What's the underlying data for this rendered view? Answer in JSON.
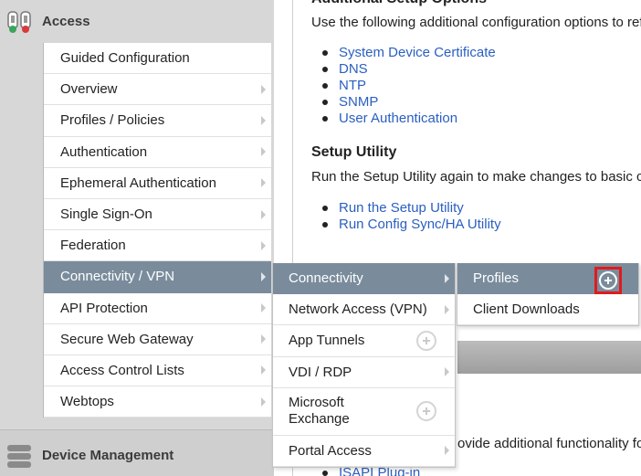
{
  "rail": {
    "header_title": "Access",
    "footer_title": "Device Management"
  },
  "menu": {
    "items": [
      {
        "label": "Guided Configuration"
      },
      {
        "label": "Overview"
      },
      {
        "label": "Profiles / Policies"
      },
      {
        "label": "Authentication"
      },
      {
        "label": "Ephemeral Authentication"
      },
      {
        "label": "Single Sign-On"
      },
      {
        "label": "Federation"
      },
      {
        "label": "Connectivity / VPN"
      },
      {
        "label": "API Protection"
      },
      {
        "label": "Secure Web Gateway"
      },
      {
        "label": "Access Control Lists"
      },
      {
        "label": "Webtops"
      }
    ]
  },
  "submenu": {
    "items": [
      {
        "label": "Connectivity"
      },
      {
        "label": "Network Access (VPN)"
      },
      {
        "label": "App Tunnels"
      },
      {
        "label": "VDI / RDP"
      },
      {
        "label": "Microsoft Exchange"
      },
      {
        "label": "Portal Access"
      }
    ]
  },
  "submenu2": {
    "items": [
      {
        "label": "Profiles"
      },
      {
        "label": "Client Downloads"
      }
    ]
  },
  "content": {
    "section1_title": "Additional Setup Options",
    "section1_text": "Use the following additional configuration options to ref",
    "section1_links": [
      "System Device Certificate",
      "DNS",
      "NTP",
      "SNMP",
      "User Authentication"
    ],
    "section2_title": "Setup Utility",
    "section2_text": "Run the Setup Utility again to make changes to basic c",
    "section2_links": [
      "Run the Setup Utility",
      "Run Config Sync/HA Utility"
    ],
    "bottom_text": "ovide additional functionality for",
    "bottom_link": "ISAPI Plug-in"
  },
  "colors": {
    "active_menu": "#7a8c9c",
    "link": "#2a5fc1",
    "highlight": "#e01b1b"
  }
}
